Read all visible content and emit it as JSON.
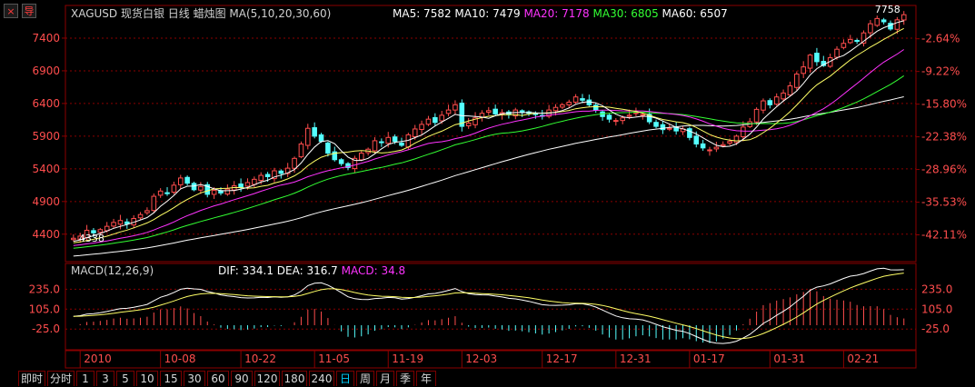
{
  "toolbar": {
    "close_glyph": "×",
    "nav_glyph": "导"
  },
  "header": {
    "symbol_title": "XAGUSD 现货白银 日线 蜡烛图 MA(5,10,20,30,60)",
    "ma": [
      {
        "label": "MA5:",
        "value": "7582",
        "color": "#ffffff"
      },
      {
        "label": "MA10:",
        "value": "7479",
        "color": "#ffffff"
      },
      {
        "label": "MA20:",
        "value": "7178",
        "color": "#ff33ff"
      },
      {
        "label": "MA30:",
        "value": "6805",
        "color": "#33ff33"
      },
      {
        "label": "MA60:",
        "value": "6507",
        "color": "#ffffff"
      }
    ]
  },
  "macd_header": {
    "title": "MACD(12,26,9)",
    "dif_label": "DIF:",
    "dif_value": "334.1",
    "dea_label": "DEA:",
    "dea_value": "316.7",
    "macd_label": "MACD:",
    "macd_value": "34.8"
  },
  "annotations": {
    "high_label": "7758",
    "low_label": "4338"
  },
  "colors": {
    "up": "#ff4d4d",
    "down": "#54ffff",
    "grid": "#8b0000",
    "axis_text": "#ff4d4d",
    "ma5": "#ffffff",
    "ma10": "#ffff66",
    "ma20": "#ff33ff",
    "ma30": "#33ff33",
    "ma60": "#ffffff"
  },
  "chart_data": [
    {
      "type": "candlestick",
      "title": "XAGUSD 现货白银 日线",
      "y_ticks": [
        4400,
        4900,
        5400,
        5900,
        6400,
        6900,
        7400
      ],
      "pct_ticks": [
        "-2.64%",
        "-9.22%",
        "-15.80%",
        "-22.38%",
        "-28.96%",
        "-35.53%",
        "-42.11%"
      ],
      "pct_tick_values": [
        7390,
        6890,
        6390,
        5890,
        5390,
        4890,
        4390
      ],
      "x_labels": [
        "2010",
        "10-08",
        "10-22",
        "11-05",
        "11-19",
        "12-03",
        "12-17",
        "12-31",
        "01-17",
        "01-31",
        "02-21"
      ],
      "x_label_index": [
        1,
        13,
        25,
        36,
        47,
        58,
        70,
        81,
        92,
        104,
        115
      ],
      "ylim": [
        3980,
        7900
      ],
      "closes": [
        4338,
        4370,
        4460,
        4420,
        4470,
        4520,
        4580,
        4610,
        4560,
        4640,
        4700,
        4760,
        4980,
        5060,
        5020,
        5150,
        5260,
        5180,
        5080,
        5130,
        5010,
        5070,
        5030,
        5090,
        5140,
        5120,
        5190,
        5240,
        5300,
        5280,
        5370,
        5330,
        5410,
        5560,
        5780,
        6020,
        5900,
        5820,
        5640,
        5540,
        5480,
        5420,
        5560,
        5640,
        5700,
        5830,
        5800,
        5880,
        5820,
        5760,
        5920,
        6010,
        6080,
        6160,
        6110,
        6220,
        6300,
        6380,
        6050,
        6100,
        6180,
        6250,
        6290,
        6240,
        6260,
        6230,
        6300,
        6270,
        6250,
        6230,
        6210,
        6300,
        6340,
        6380,
        6420,
        6500,
        6450,
        6380,
        6300,
        6200,
        6160,
        6140,
        6180,
        6220,
        6260,
        6230,
        6120,
        6050,
        6000,
        6020,
        5980,
        6010,
        5880,
        5780,
        5720,
        5690,
        5730,
        5770,
        5820,
        5900,
        6040,
        6120,
        6310,
        6440,
        6380,
        6500,
        6560,
        6670,
        6850,
        6960,
        7140,
        7040,
        6980,
        7100,
        7230,
        7320,
        7380,
        7350,
        7480,
        7620,
        7700,
        7650,
        7540,
        7680,
        7758
      ],
      "ma_series": [
        "ma5",
        "ma10",
        "ma20",
        "ma30",
        "ma60"
      ]
    },
    {
      "type": "macd",
      "title": "MACD(12,26,9)",
      "y_ticks": [
        235.0,
        105.0,
        -25.0
      ],
      "ylim": [
        -160,
        320
      ]
    }
  ],
  "tabs": [
    {
      "label": "即时",
      "active": false
    },
    {
      "label": "分时",
      "active": false
    },
    {
      "label": "1",
      "active": false
    },
    {
      "label": "3",
      "active": false
    },
    {
      "label": "5",
      "active": false
    },
    {
      "label": "10",
      "active": false
    },
    {
      "label": "15",
      "active": false
    },
    {
      "label": "30",
      "active": false
    },
    {
      "label": "60",
      "active": false
    },
    {
      "label": "90",
      "active": false
    },
    {
      "label": "120",
      "active": false
    },
    {
      "label": "180",
      "active": false
    },
    {
      "label": "240",
      "active": false
    },
    {
      "label": "日",
      "active": true
    },
    {
      "label": "周",
      "active": false
    },
    {
      "label": "月",
      "active": false
    },
    {
      "label": "季",
      "active": false
    },
    {
      "label": "年",
      "active": false
    }
  ]
}
